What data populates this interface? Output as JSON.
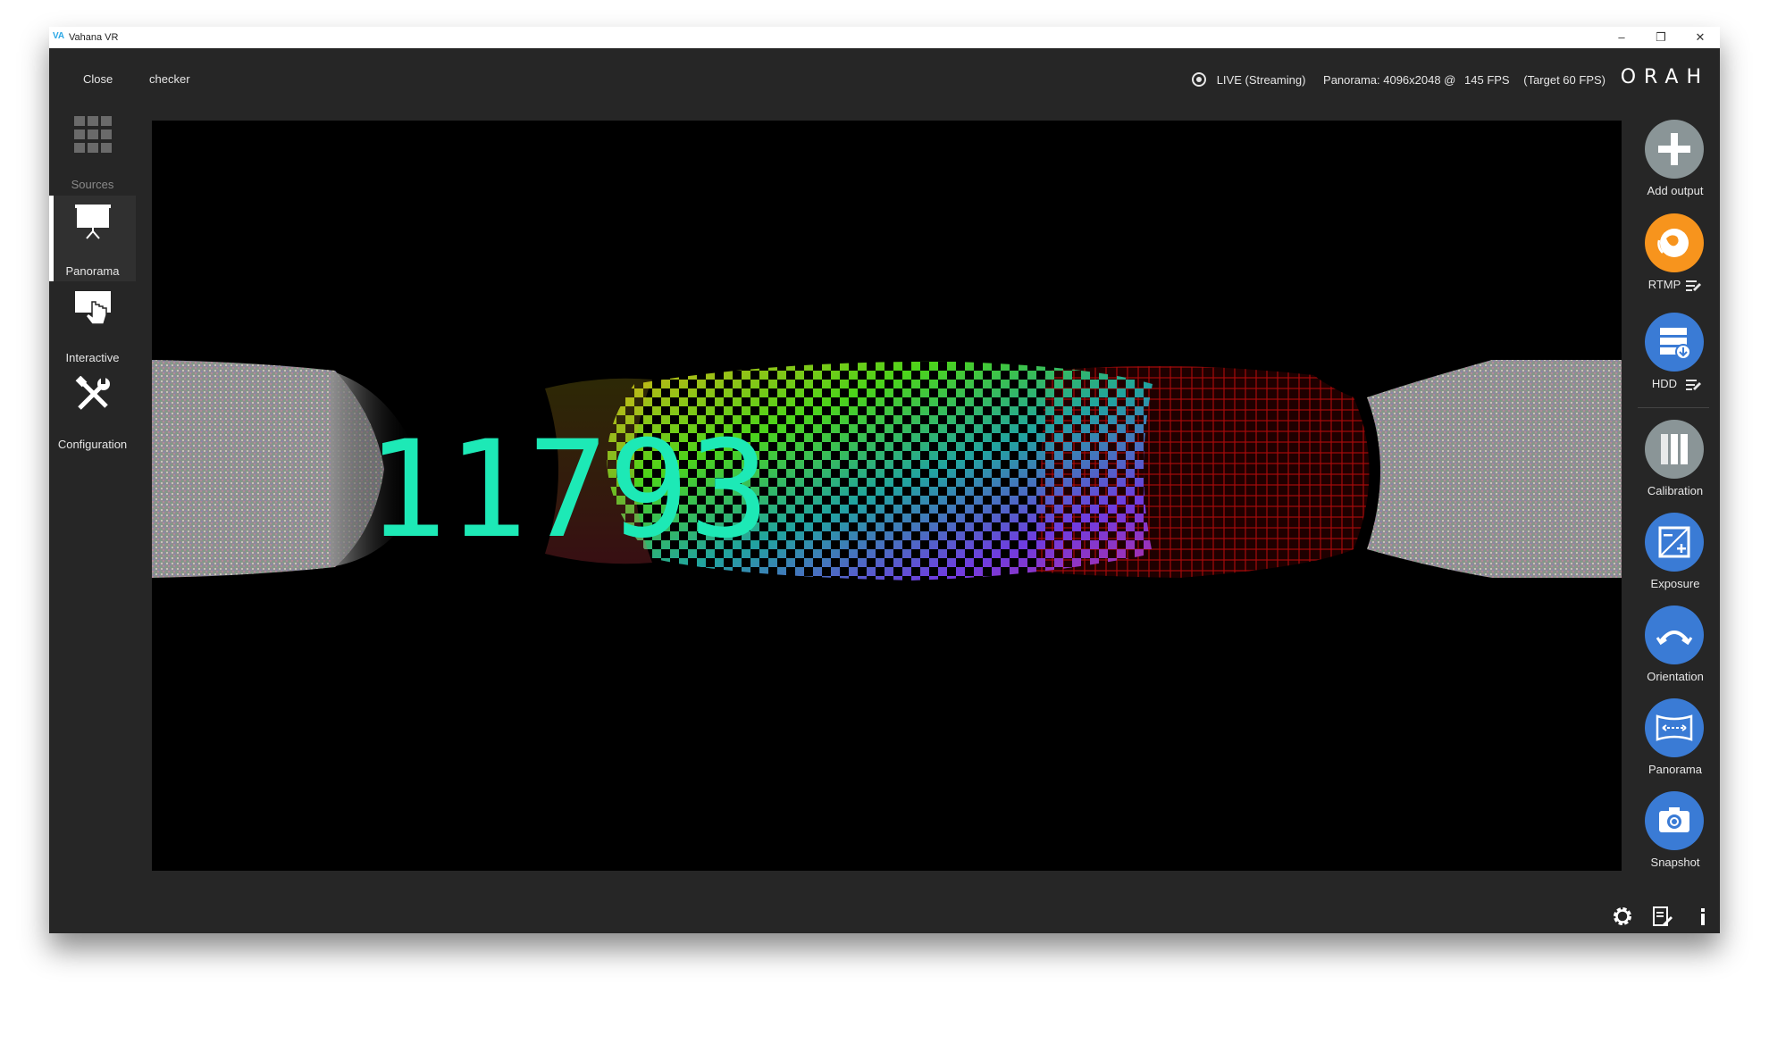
{
  "titlebar": {
    "logo": "VA",
    "title": "Vahana VR",
    "minimize": "–",
    "maximize": "❐",
    "close": "✕"
  },
  "topbar": {
    "menu": [
      "Close",
      "checker"
    ],
    "status_live": "LIVE (Streaming)",
    "status_panorama": "Panorama: 4096x2048 @",
    "status_fps": "145 FPS",
    "status_target": "(Target 60 FPS)",
    "brand": "ORAH"
  },
  "leftnav": [
    {
      "label": "Sources",
      "icon": "grid-icon",
      "state": "dim"
    },
    {
      "label": "Panorama",
      "icon": "projector-icon",
      "state": "active"
    },
    {
      "label": "Interactive",
      "icon": "hand-pointer-icon",
      "state": "normal"
    },
    {
      "label": "Configuration",
      "icon": "tools-icon",
      "state": "normal"
    }
  ],
  "viewport": {
    "overlay_number": "11793",
    "overlay_color": "#1de9b6"
  },
  "rightbar": [
    {
      "label": "Add output",
      "icon": "plus-icon",
      "color": "#8a9597"
    },
    {
      "label": "RTMP",
      "icon": "globe-stream-icon",
      "color": "#f7941d",
      "has_edit": true
    },
    {
      "label": "HDD",
      "icon": "hdd-download-icon",
      "color": "#3a7bd5",
      "has_edit": true
    },
    {
      "label": "Calibration",
      "icon": "calibration-icon",
      "color": "#8a9597"
    },
    {
      "label": "Exposure",
      "icon": "exposure-icon",
      "color": "#3a7bd5"
    },
    {
      "label": "Orientation",
      "icon": "orientation-icon",
      "color": "#3a7bd5"
    },
    {
      "label": "Panorama",
      "icon": "panorama-icon",
      "color": "#3a7bd5"
    },
    {
      "label": "Snapshot",
      "icon": "camera-icon",
      "color": "#3a7bd5"
    }
  ],
  "bottombar": {
    "icons": [
      "settings-icon",
      "log-icon",
      "info-icon"
    ]
  }
}
